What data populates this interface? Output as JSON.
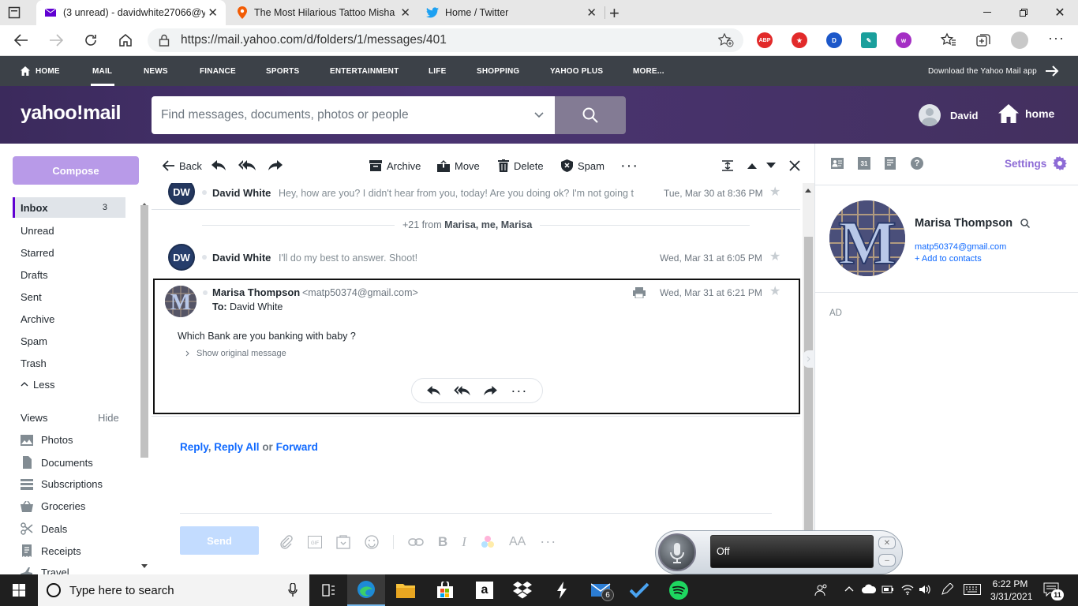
{
  "browser": {
    "tabs": [
      {
        "title": "(3 unread) - davidwhite27066@y",
        "active": true
      },
      {
        "title": "The Most Hilarious Tattoo Misha",
        "active": false
      },
      {
        "title": "Home / Twitter",
        "active": false
      }
    ],
    "url": "https://mail.yahoo.com/d/folders/1/messages/401",
    "extensions": [
      "ABP",
      "D"
    ]
  },
  "yahoo_nav": {
    "items": [
      "HOME",
      "MAIL",
      "NEWS",
      "FINANCE",
      "SPORTS",
      "ENTERTAINMENT",
      "LIFE",
      "SHOPPING",
      "YAHOO PLUS",
      "MORE..."
    ],
    "download_app": "Download the Yahoo Mail app"
  },
  "header": {
    "logo": "yahoo!mail",
    "search_placeholder": "Find messages, documents, photos or people",
    "user": "David",
    "home": "home"
  },
  "sidebar": {
    "compose": "Compose",
    "folders": [
      {
        "label": "Inbox",
        "count": "3"
      },
      {
        "label": "Unread",
        "count": ""
      },
      {
        "label": "Starred",
        "count": ""
      },
      {
        "label": "Drafts",
        "count": ""
      },
      {
        "label": "Sent",
        "count": ""
      },
      {
        "label": "Archive",
        "count": ""
      },
      {
        "label": "Spam",
        "count": ""
      },
      {
        "label": "Trash",
        "count": ""
      }
    ],
    "less": "Less",
    "views_label": "Views",
    "hide_label": "Hide",
    "views": [
      "Photos",
      "Documents",
      "Subscriptions",
      "Groceries",
      "Deals",
      "Receipts",
      "Travel"
    ]
  },
  "toolbar": {
    "back": "Back",
    "archive": "Archive",
    "move": "Move",
    "delete": "Delete",
    "spam": "Spam"
  },
  "thread": {
    "messages": [
      {
        "initials": "DW",
        "sender": "David White",
        "snippet": "Hey, how are you? I didn't hear from you, today! Are you doing ok? I'm not going t",
        "date": "Tue, Mar 30 at 8:36 PM"
      },
      {
        "initials": "DW",
        "sender": "David White",
        "snippet": "I'll do my best to answer. Shoot!",
        "date": "Wed, Mar 31 at 6:05 PM"
      }
    ],
    "collapsed_prefix": "+21 from",
    "collapsed_names": "Marisa, me, Marisa",
    "open_message": {
      "sender": "Marisa Thompson",
      "email": "<matp50374@gmail.com>",
      "to_label": "To:",
      "to": "David White",
      "date": "Wed, Mar 31 at 6:21 PM",
      "body": "Which Bank are you banking with baby ?",
      "show_original": "Show original message"
    },
    "reply_links": {
      "reply": "Reply",
      "reply_all": "Reply All",
      "or": "or",
      "forward": "Forward"
    },
    "send": "Send"
  },
  "right_panel": {
    "settings": "Settings",
    "contact_name": "Marisa Thompson",
    "contact_email": "matp50374@gmail.com",
    "add_contacts": "+ Add to contacts",
    "ad_label": "AD"
  },
  "voice_widget": {
    "status": "Off"
  },
  "taskbar": {
    "search_placeholder": "Type here to search",
    "time": "6:22 PM",
    "date": "3/31/2021",
    "mail_badge": "6",
    "notif_badge": "11"
  },
  "colors": {
    "yahoo_purple": "#6001d2",
    "compose": "#b89ae8",
    "link_blue": "#0f69ff",
    "nav_bg": "#3c4148"
  }
}
